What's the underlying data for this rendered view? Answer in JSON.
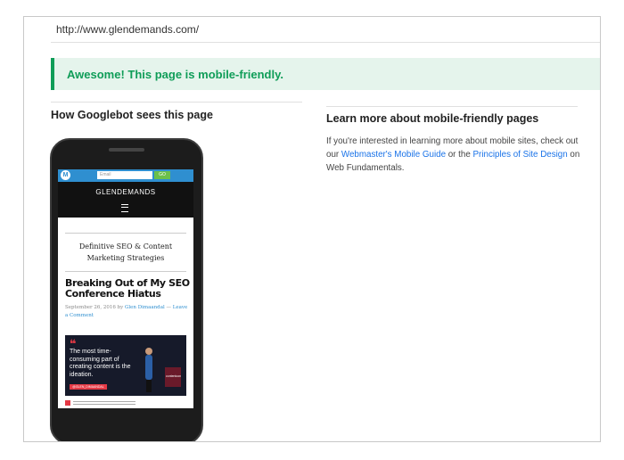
{
  "url_bar": {
    "url": "http://www.glendemands.com/"
  },
  "result_banner": {
    "message": "Awesome! This page is mobile-friendly."
  },
  "left_section": {
    "heading": "How Googlebot sees this page"
  },
  "right_section": {
    "heading": "Learn more about mobile-friendly pages",
    "body_prefix": "If you're interested in learning more about mobile sites, check out our ",
    "link_webmasters": "Webmaster's Mobile Guide",
    "body_middle": " or the ",
    "link_principles": "Principles of Site Design",
    "body_suffix": " on Web Fundamentals."
  },
  "phone_preview": {
    "topbar": {
      "logo": "M",
      "search_placeholder": "Email",
      "button_label": "GO"
    },
    "brand": "GLENDEMANDS",
    "tagline": "Definitive SEO & Content Marketing Strategies",
    "post_title": "Breaking Out of My SEO Conference Hiatus",
    "post_meta": {
      "date_by": "September 26, 2016 by ",
      "author": "Glen Dimaandal",
      "sep": " — ",
      "comment": "Leave a Comment"
    },
    "image": {
      "quote_mark": "❝",
      "quote": "The most time-consuming part of creating content is the ideation.",
      "tag": "@GLEN_DIMAANDAL",
      "stage_label": "contentcon"
    }
  },
  "colors": {
    "banner_bg": "#e5f4ec",
    "banner_accent": "#0f9d58",
    "link": "#1a73e8",
    "site_topbar": "#2f8fd0"
  },
  "icons": [
    "site-logo-icon",
    "hamburger-menu-icon",
    "quote-mark-icon"
  ]
}
